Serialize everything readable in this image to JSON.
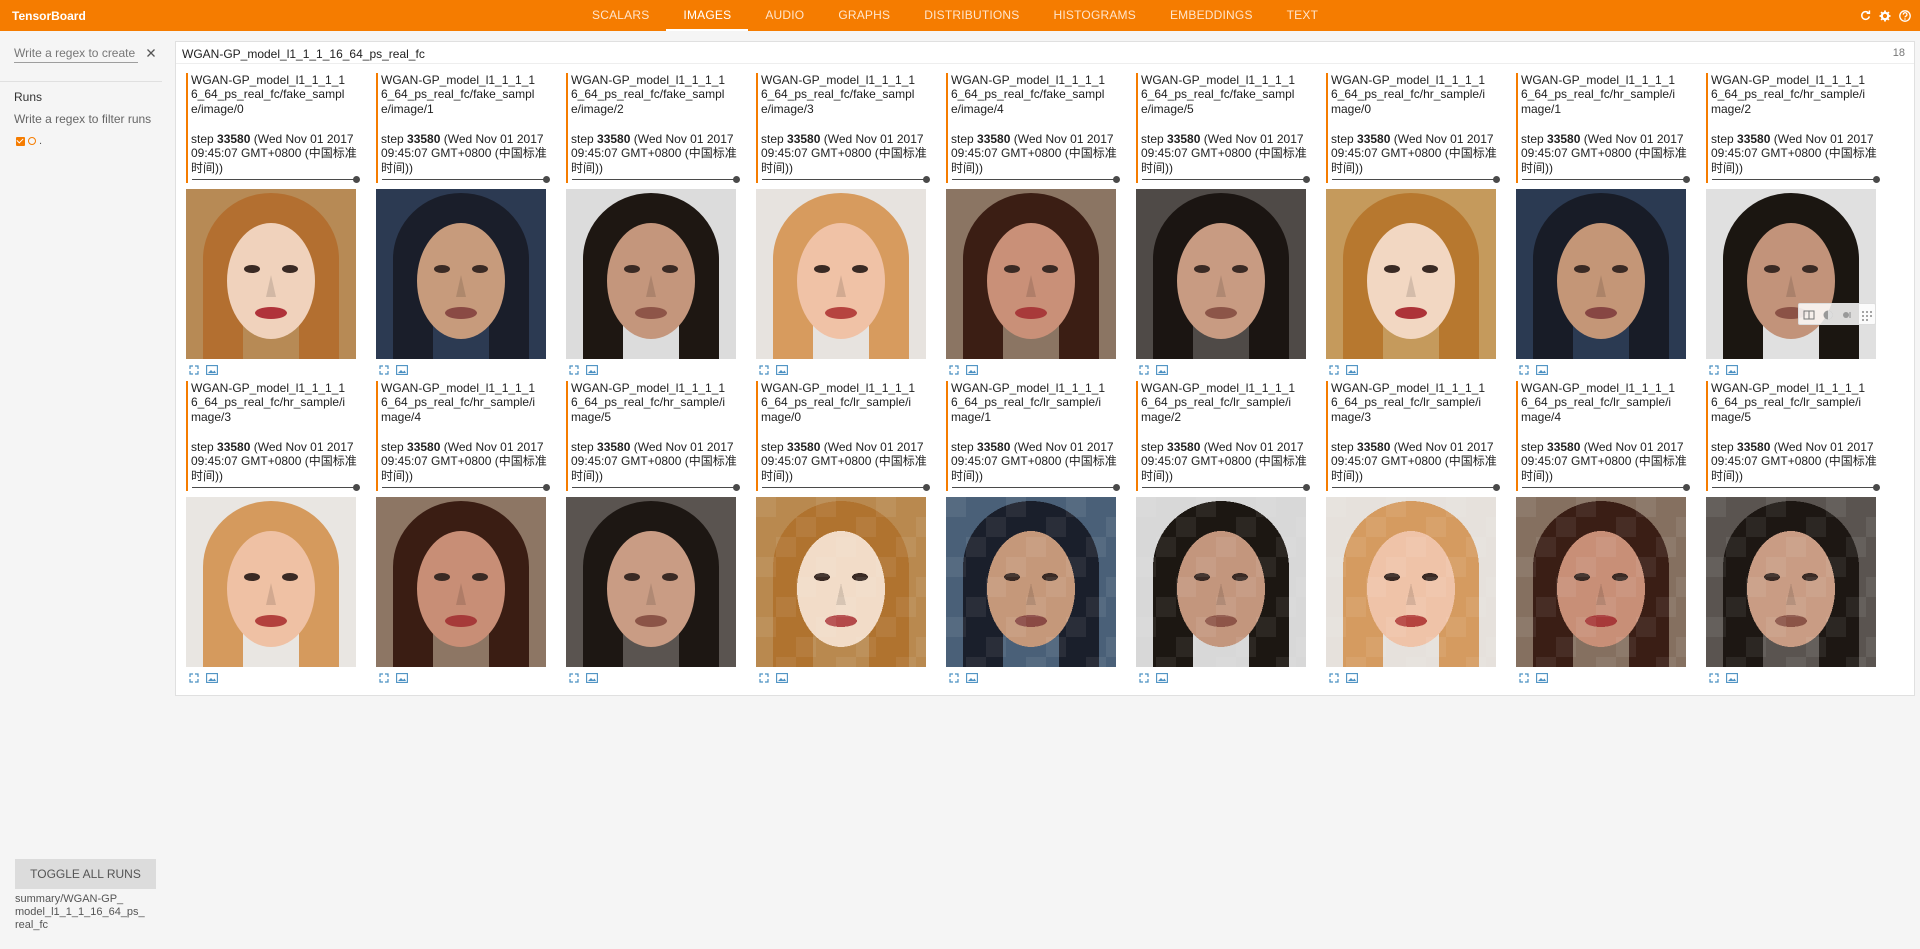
{
  "app": {
    "title": "TensorBoard"
  },
  "tabs": [
    {
      "label": "SCALARS",
      "active": false
    },
    {
      "label": "IMAGES",
      "active": true
    },
    {
      "label": "AUDIO",
      "active": false
    },
    {
      "label": "GRAPHS",
      "active": false
    },
    {
      "label": "DISTRIBUTIONS",
      "active": false
    },
    {
      "label": "HISTOGRAMS",
      "active": false
    },
    {
      "label": "EMBEDDINGS",
      "active": false
    },
    {
      "label": "TEXT",
      "active": false
    }
  ],
  "top_icons": [
    "refresh-icon",
    "settings-icon",
    "help-icon"
  ],
  "sidebar": {
    "tag_filter_placeholder": "Write a regex to create a tag group",
    "runs_title": "Runs",
    "runs_filter_placeholder": "Write a regex to filter runs",
    "run_name": ".",
    "toggle_all_label": "TOGGLE ALL RUNS",
    "summary_path": "summary/WGAN-GP_\nmodel_l1_1_1_16_64_ps_\nreal_fc"
  },
  "colors": {
    "brand": "#f57c00",
    "run": "#f57c00"
  },
  "category": {
    "title": "WGAN-GP_model_l1_1_1_16_64_ps_real_fc",
    "count": "18"
  },
  "cards": [
    {
      "name": "WGAN-GP_model_l1_1_1_16_64_ps_real_fc/fake_sample/image/0",
      "step_prefix": "step ",
      "step": "33580",
      "time": " (Wed Nov 01 2017 09:45:07 GMT+0800 (中国标准时间))",
      "face": {
        "bg": "#b78a55",
        "hair": "#b36f30",
        "skin": "#f0d2bc",
        "mouth": "#b0333a",
        "pix": 1
      }
    },
    {
      "name": "WGAN-GP_model_l1_1_1_16_64_ps_real_fc/fake_sample/image/1",
      "step_prefix": "step ",
      "step": "33580",
      "time": " (Wed Nov 01 2017 09:45:07 GMT+0800 (中国标准时间))",
      "face": {
        "bg": "#2c3a52",
        "hair": "#1a1e2a",
        "skin": "#c79b7c",
        "mouth": "#8a4a44",
        "pix": 1
      }
    },
    {
      "name": "WGAN-GP_model_l1_1_1_16_64_ps_real_fc/fake_sample/image/2",
      "step_prefix": "step ",
      "step": "33580",
      "time": " (Wed Nov 01 2017 09:45:07 GMT+0800 (中国标准时间))",
      "face": {
        "bg": "#dcdcdc",
        "hair": "#1e1712",
        "skin": "#c4967c",
        "mouth": "#8e5548",
        "pix": 1
      }
    },
    {
      "name": "WGAN-GP_model_l1_1_1_16_64_ps_real_fc/fake_sample/image/3",
      "step_prefix": "step ",
      "step": "33580",
      "time": " (Wed Nov 01 2017 09:45:07 GMT+0800 (中国标准时间))",
      "face": {
        "bg": "#e7e3df",
        "hair": "#d79b5e",
        "skin": "#f0c2a6",
        "mouth": "#b6443f",
        "pix": 1
      }
    },
    {
      "name": "WGAN-GP_model_l1_1_1_16_64_ps_real_fc/fake_sample/image/4",
      "step_prefix": "step ",
      "step": "33580",
      "time": " (Wed Nov 01 2017 09:45:07 GMT+0800 (中国标准时间))",
      "face": {
        "bg": "#8b7563",
        "hair": "#3b1e14",
        "skin": "#c99078",
        "mouth": "#a83a3a",
        "pix": 1
      }
    },
    {
      "name": "WGAN-GP_model_l1_1_1_16_64_ps_real_fc/fake_sample/image/5",
      "step_prefix": "step ",
      "step": "33580",
      "time": " (Wed Nov 01 2017 09:45:07 GMT+0800 (中国标准时间))",
      "face": {
        "bg": "#4f4a47",
        "hair": "#1b1512",
        "skin": "#c89b82",
        "mouth": "#8c5548",
        "pix": 1
      }
    },
    {
      "name": "WGAN-GP_model_l1_1_1_16_64_ps_real_fc/hr_sample/image/0",
      "step_prefix": "step ",
      "step": "33580",
      "time": " (Wed Nov 01 2017 09:45:07 GMT+0800 (中国标准时间))",
      "face": {
        "bg": "#c59a5c",
        "hair": "#b7782f",
        "skin": "#f2d7c2",
        "mouth": "#ad3338",
        "pix": 1
      }
    },
    {
      "name": "WGAN-GP_model_l1_1_1_16_64_ps_real_fc/hr_sample/image/1",
      "step_prefix": "step ",
      "step": "33580",
      "time": " (Wed Nov 01 2017 09:45:07 GMT+0800 (中国标准时间))",
      "face": {
        "bg": "#2b3a52",
        "hair": "#181c27",
        "skin": "#c49677",
        "mouth": "#874643",
        "pix": 1
      }
    },
    {
      "name": "WGAN-GP_model_l1_1_1_16_64_ps_real_fc/hr_sample/image/2",
      "step_prefix": "step ",
      "step": "33580",
      "time": " (Wed Nov 01 2017 09:45:07 GMT+0800 (中国标准时间))",
      "face": {
        "bg": "#e0e0e0",
        "hair": "#1b1611",
        "skin": "#c2937a",
        "mouth": "#8b5246",
        "pix": 1
      }
    },
    {
      "name": "WGAN-GP_model_l1_1_1_16_64_ps_real_fc/hr_sample/image/3",
      "step_prefix": "step ",
      "step": "33580",
      "time": " (Wed Nov 01 2017 09:45:07 GMT+0800 (中国标准时间))",
      "face": {
        "bg": "#e9e6e2",
        "hair": "#d59a5d",
        "skin": "#efc1a4",
        "mouth": "#b3413d",
        "pix": 1
      }
    },
    {
      "name": "WGAN-GP_model_l1_1_1_16_64_ps_real_fc/hr_sample/image/4",
      "step_prefix": "step ",
      "step": "33580",
      "time": " (Wed Nov 01 2017 09:45:07 GMT+0800 (中国标准时间))",
      "face": {
        "bg": "#8d7664",
        "hair": "#3a1d13",
        "skin": "#c88e76",
        "mouth": "#a63a39",
        "pix": 1
      }
    },
    {
      "name": "WGAN-GP_model_l1_1_1_16_64_ps_real_fc/hr_sample/image/5",
      "step_prefix": "step ",
      "step": "33580",
      "time": " (Wed Nov 01 2017 09:45:07 GMT+0800 (中国标准时间))",
      "face": {
        "bg": "#5a5450",
        "hair": "#1d1713",
        "skin": "#c99c84",
        "mouth": "#8b5447",
        "pix": 1
      }
    },
    {
      "name": "WGAN-GP_model_l1_1_1_16_64_ps_real_fc/lr_sample/image/0",
      "step_prefix": "step ",
      "step": "33580",
      "time": " (Wed Nov 01 2017 09:45:07 GMT+0800 (中国标准时间))",
      "face": {
        "bg": "#b9894f",
        "hair": "#b0732f",
        "skin": "#f2dcc8",
        "mouth": "#b44a4a",
        "pix": 10
      }
    },
    {
      "name": "WGAN-GP_model_l1_1_1_16_64_ps_real_fc/lr_sample/image/1",
      "step_prefix": "step ",
      "step": "33580",
      "time": " (Wed Nov 01 2017 09:45:07 GMT+0800 (中国标准时间))",
      "face": {
        "bg": "#4a6078",
        "hair": "#1a1f2b",
        "skin": "#c5987a",
        "mouth": "#8a4a44",
        "pix": 10
      }
    },
    {
      "name": "WGAN-GP_model_l1_1_1_16_64_ps_real_fc/lr_sample/image/2",
      "step_prefix": "step ",
      "step": "33580",
      "time": " (Wed Nov 01 2017 09:45:07 GMT+0800 (中国标准时间))",
      "face": {
        "bg": "#d8d8d8",
        "hair": "#1c1712",
        "skin": "#c3967d",
        "mouth": "#8e5548",
        "pix": 10
      }
    },
    {
      "name": "WGAN-GP_model_l1_1_1_16_64_ps_real_fc/lr_sample/image/3",
      "step_prefix": "step ",
      "step": "33580",
      "time": " (Wed Nov 01 2017 09:45:07 GMT+0800 (中国标准时间))",
      "face": {
        "bg": "#e6e1dc",
        "hair": "#d59b60",
        "skin": "#efc3a8",
        "mouth": "#b5443f",
        "pix": 10
      }
    },
    {
      "name": "WGAN-GP_model_l1_1_1_16_64_ps_real_fc/lr_sample/image/4",
      "step_prefix": "step ",
      "step": "33580",
      "time": " (Wed Nov 01 2017 09:45:07 GMT+0800 (中国标准时间))",
      "face": {
        "bg": "#857060",
        "hair": "#3a1e15",
        "skin": "#c88f77",
        "mouth": "#a73a39",
        "pix": 10
      }
    },
    {
      "name": "WGAN-GP_model_l1_1_1_16_64_ps_real_fc/lr_sample/image/5",
      "step_prefix": "step ",
      "step": "33580",
      "time": " (Wed Nov 01 2017 09:45:07 GMT+0800 (中国标准时间))",
      "face": {
        "bg": "#5a5450",
        "hair": "#1d1713",
        "skin": "#c99c84",
        "mouth": "#8b5447",
        "pix": 10
      }
    }
  ],
  "image_tools": [
    "compare-icon",
    "brightness-icon",
    "contrast-icon",
    "drag-handle-icon"
  ]
}
